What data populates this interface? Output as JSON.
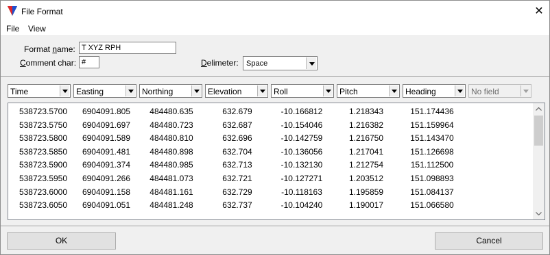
{
  "window": {
    "title": "File Format",
    "close_glyph": "✕"
  },
  "menu": {
    "file": "File",
    "view": "View"
  },
  "form": {
    "format_name_label_pre": "Format ",
    "format_name_label_u": "n",
    "format_name_label_post": "ame:",
    "format_name_value": "T XYZ RPH",
    "comment_char_label_u": "C",
    "comment_char_label_post": "omment char:",
    "comment_char_value": "#",
    "delimiter_label_u": "D",
    "delimiter_label_post": "elimeter:",
    "delimiter_value": "Space"
  },
  "fields": [
    "Time",
    "Easting",
    "Northing",
    "Elevation",
    "Roll",
    "Pitch",
    "Heading",
    "No field"
  ],
  "rows": [
    [
      "538723.5700",
      "6904091.805",
      "484480.635",
      "632.679",
      "-10.166812",
      "1.218343",
      "151.174436"
    ],
    [
      "538723.5750",
      "6904091.697",
      "484480.723",
      "632.687",
      "-10.154046",
      "1.216382",
      "151.159964"
    ],
    [
      "538723.5800",
      "6904091.589",
      "484480.810",
      "632.696",
      "-10.142759",
      "1.216750",
      "151.143470"
    ],
    [
      "538723.5850",
      "6904091.481",
      "484480.898",
      "632.704",
      "-10.136056",
      "1.217041",
      "151.126698"
    ],
    [
      "538723.5900",
      "6904091.374",
      "484480.985",
      "632.713",
      "-10.132130",
      "1.212754",
      "151.112500"
    ],
    [
      "538723.5950",
      "6904091.266",
      "484481.073",
      "632.721",
      "-10.127271",
      "1.203512",
      "151.098893"
    ],
    [
      "538723.6000",
      "6904091.158",
      "484481.161",
      "632.729",
      "-10.118163",
      "1.195859",
      "151.084137"
    ],
    [
      "538723.6050",
      "6904091.051",
      "484481.248",
      "632.737",
      "-10.104240",
      "1.190017",
      "151.066580"
    ]
  ],
  "buttons": {
    "ok": "OK",
    "cancel": "Cancel"
  },
  "colors": {
    "icon_red": "#e0262b",
    "icon_green": "#2e9b3a",
    "icon_blue": "#1f4fd0"
  }
}
